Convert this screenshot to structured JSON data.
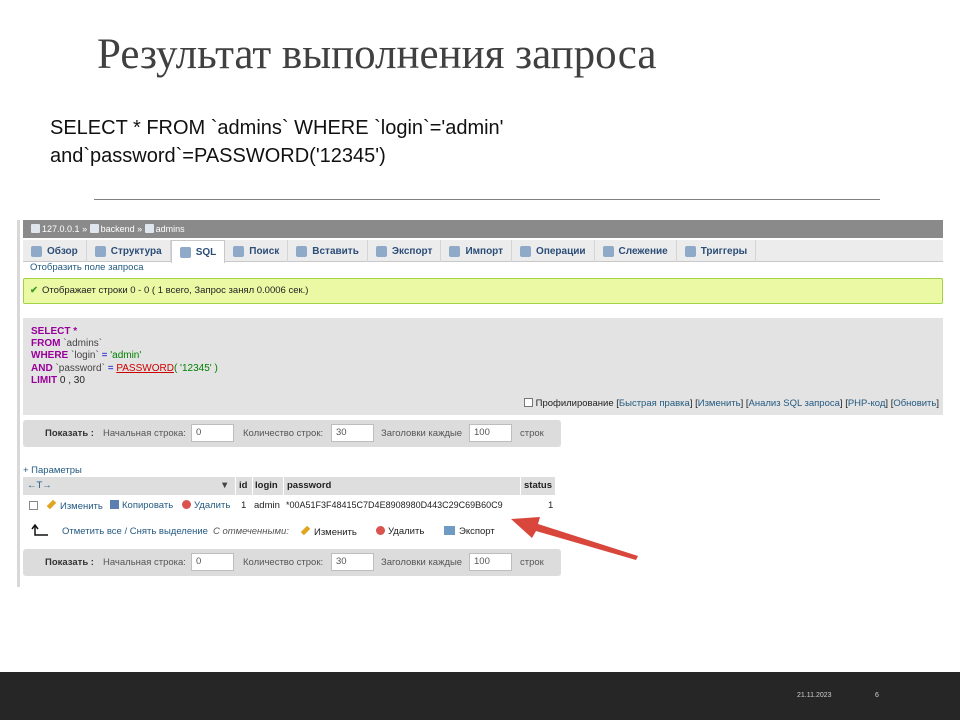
{
  "slide": {
    "title": "Результат выполнения запроса",
    "query_line1": "SELECT * FROM `admins` WHERE `login`='admin'",
    "query_line2": "and`password`=PASSWORD('12345')",
    "date": "21.11.2023",
    "page_number": "6"
  },
  "breadcrumb": {
    "server": "127.0.0.1",
    "sep": "»",
    "database": "backend",
    "table": "admins"
  },
  "tabs": [
    {
      "label": "Обзор",
      "icon": "browse-icon"
    },
    {
      "label": "Структура",
      "icon": "structure-icon"
    },
    {
      "label": "SQL",
      "icon": "sql-icon"
    },
    {
      "label": "Поиск",
      "icon": "search-icon"
    },
    {
      "label": "Вставить",
      "icon": "insert-icon"
    },
    {
      "label": "Экспорт",
      "icon": "export-icon"
    },
    {
      "label": "Импорт",
      "icon": "import-icon"
    },
    {
      "label": "Операции",
      "icon": "operations-icon"
    },
    {
      "label": "Слежение",
      "icon": "tracking-icon"
    },
    {
      "label": "Триггеры",
      "icon": "triggers-icon"
    }
  ],
  "show_query_link": "Отобразить поле запроса",
  "success_message": "Отображает строки 0 - 0 ( 1 всего, Запрос занял 0.0006 сек.)",
  "sql": {
    "select": "SELECT",
    "star": " *",
    "from": "FROM",
    "table": " `admins`",
    "where": "WHERE",
    "login_col": " `login`",
    "eq": " = ",
    "login_val": "'admin'",
    "and": "AND",
    "password_col": " `password`",
    "password_fn": "PASSWORD",
    "password_arg": "( '12345' )",
    "limit": "LIMIT",
    "limit_val": " 0 , 30"
  },
  "profiling": {
    "label": "Профилирование",
    "open": "[",
    "quick_edit": "Быстрая правка",
    "edit": "Изменить",
    "analyze": "Анализ SQL запроса",
    "php_code": "PHP-код",
    "refresh": "Обновить",
    "sep": "] [",
    "close": "]"
  },
  "nav": {
    "show_label": "Показать :",
    "start_row_label": "Начальная строка:",
    "start_row_value": "0",
    "row_count_label": "Количество строк:",
    "row_count_value": "30",
    "headers_every_label": "Заголовки каждые",
    "headers_every_value": "100",
    "rows_suffix": "строк"
  },
  "options_link": "+ Параметры",
  "table": {
    "sort_arrows": "←T→",
    "columns": [
      "id",
      "login",
      "password",
      "status"
    ],
    "row": {
      "edit": "Изменить",
      "copy": "Копировать",
      "delete": "Удалить",
      "id": "1",
      "login": "admin",
      "password": "*00A51F3F48415C7D4E8908980D443C29C69B60C9",
      "status": "1"
    }
  },
  "bulk": {
    "check_all": "Отметить все / Снять выделение",
    "with_selected": "С отмеченными:",
    "edit": "Изменить",
    "delete": "Удалить",
    "export": "Экспорт"
  },
  "colors": {
    "footer": "#262626",
    "success_bg": "#ebf8a4",
    "arrow": "#d9473c"
  }
}
